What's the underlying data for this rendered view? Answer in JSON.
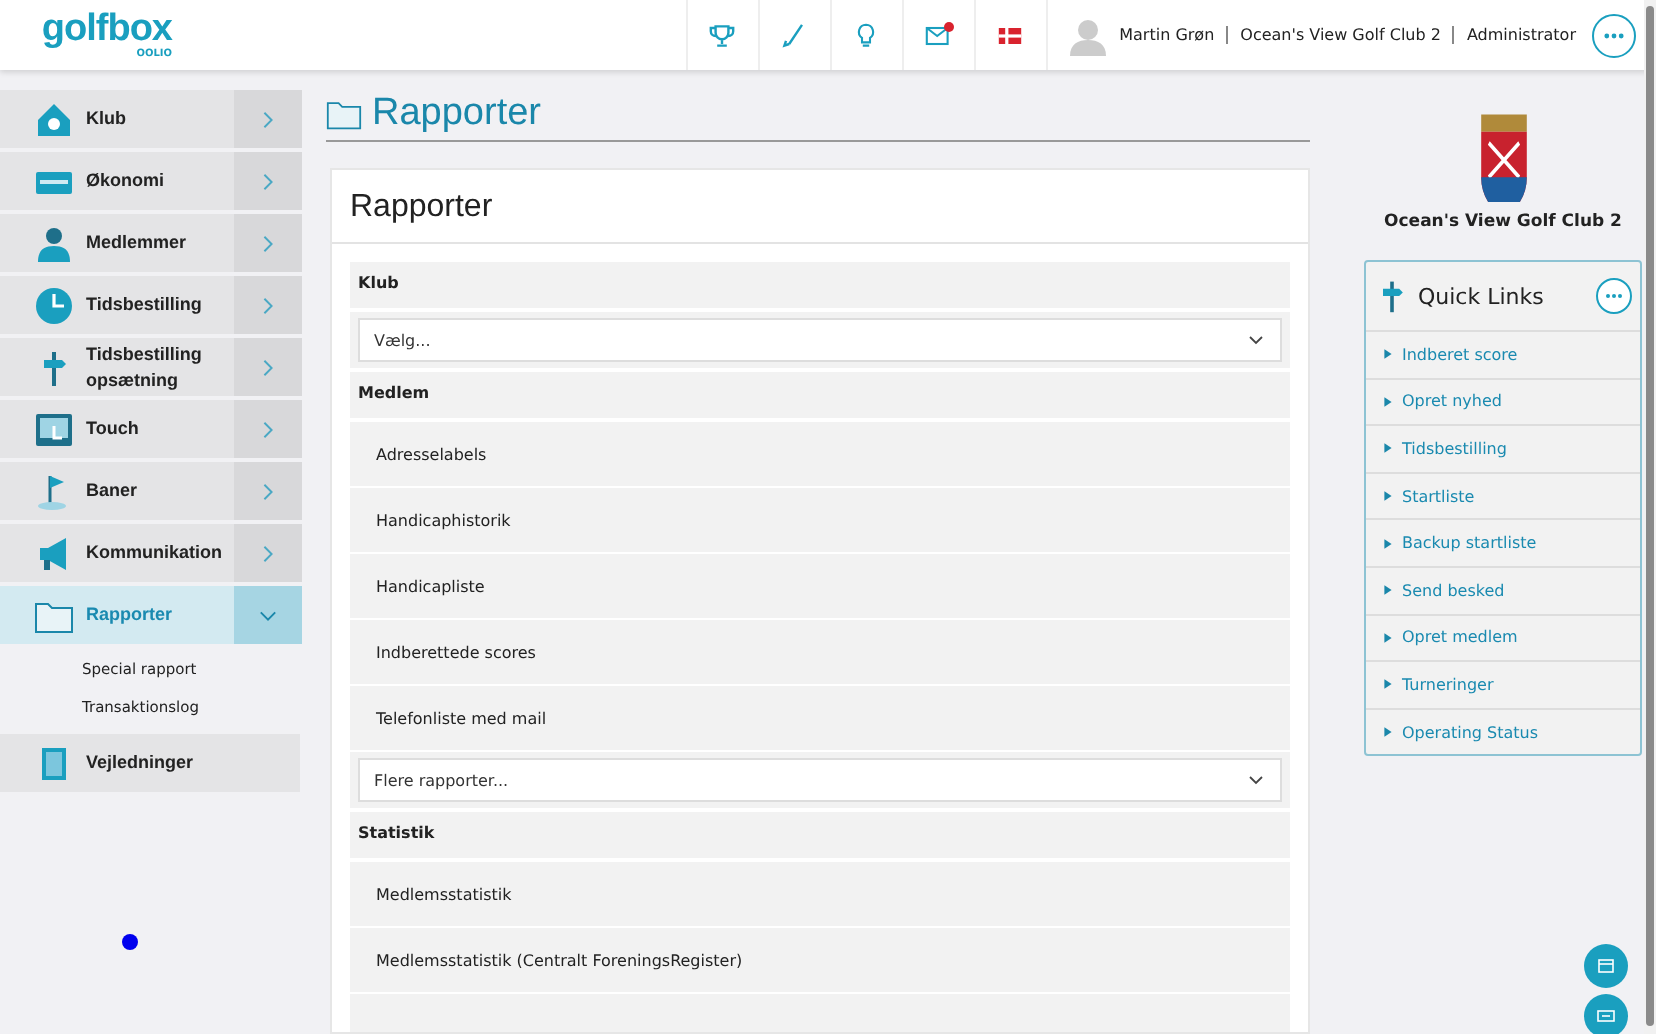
{
  "header": {
    "logo": "golfbox",
    "logo_sub": "OOLIO",
    "tool_icons": [
      {
        "kind": "trophy"
      },
      {
        "kind": "club"
      },
      {
        "kind": "bulb"
      },
      {
        "kind": "mail",
        "badge": true
      },
      {
        "kind": "flag"
      }
    ],
    "user": {
      "name": "Martin Grøn",
      "club": "Ocean's View Golf Club 2",
      "role": "Administrator"
    }
  },
  "sidebar": {
    "items": [
      {
        "label": "Klub",
        "selected": false,
        "expanded": false
      },
      {
        "label": "Økonomi",
        "selected": false,
        "expanded": false
      },
      {
        "label": "Medlemmer",
        "selected": false,
        "expanded": false
      },
      {
        "label": "Tidsbestilling",
        "selected": false,
        "expanded": false
      },
      {
        "label": "Tidsbestilling opsætning",
        "selected": false,
        "expanded": false
      },
      {
        "label": "Touch",
        "selected": false,
        "expanded": false
      },
      {
        "label": "Baner",
        "selected": false,
        "expanded": false
      },
      {
        "label": "Kommunikation",
        "selected": false,
        "expanded": false
      },
      {
        "label": "Rapporter",
        "selected": true,
        "expanded": true,
        "children": [
          {
            "label": "Special rapport"
          },
          {
            "label": "Transaktionslog"
          }
        ]
      },
      {
        "label": "Vejledninger",
        "selected": false,
        "kind": "plain"
      }
    ]
  },
  "page_title": "Rapporter",
  "card": {
    "title": "Rapporter",
    "rows": [
      {
        "kind": "header",
        "label": "Klub"
      },
      {
        "kind": "select",
        "value": "Vælg..."
      },
      {
        "kind": "header",
        "label": "Medlem"
      },
      {
        "kind": "item",
        "label": "Adresselabels"
      },
      {
        "kind": "item",
        "label": "Handicaphistorik"
      },
      {
        "kind": "item",
        "label": "Handicapliste"
      },
      {
        "kind": "item",
        "label": "Indberettede scores"
      },
      {
        "kind": "item",
        "label": "Telefonliste med mail"
      },
      {
        "kind": "select",
        "value": "Flere rapporter..."
      },
      {
        "kind": "header",
        "label": "Statistik"
      },
      {
        "kind": "item",
        "label": "Medlemsstatistik"
      },
      {
        "kind": "item",
        "label": "Medlemsstatistik (Centralt ForeningsRegister)"
      },
      {
        "kind": "item"
      }
    ]
  },
  "club": {
    "name": "Ocean's View Golf Club 2"
  },
  "quick_links": {
    "title": "Quick Links",
    "items": [
      "Indberet score",
      "Opret nyhed",
      "Tidsbestilling",
      "Startliste",
      "Backup startliste",
      "Send besked",
      "Opret medlem",
      "Turneringer",
      "Operating Status"
    ]
  }
}
